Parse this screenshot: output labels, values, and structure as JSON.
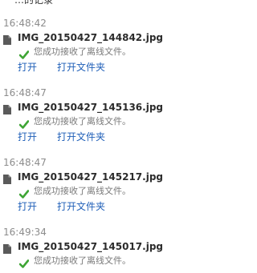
{
  "top_fragment": "…的记录",
  "entries": [
    {
      "time": "16:48:42",
      "file_name": "IMG_20150427_144842.jpg",
      "status": "您成功接收了离线文件。",
      "open_label": "打开",
      "open_folder_label": "打开文件夹"
    },
    {
      "time": "16:48:47",
      "file_name": "IMG_20150427_145136.jpg",
      "status": "您成功接收了离线文件。",
      "open_label": "打开",
      "open_folder_label": "打开文件夹"
    },
    {
      "time": "16:48:47",
      "file_name": "IMG_20150427_145217.jpg",
      "status": "您成功接收了离线文件。",
      "open_label": "打开",
      "open_folder_label": "打开文件夹"
    },
    {
      "time": "16:49:34",
      "file_name": "IMG_20150427_145017.jpg",
      "status": "您成功接收了离线文件。"
    }
  ],
  "icons": {
    "file": "file-icon",
    "check": "check-icon"
  },
  "colors": {
    "link": "#1f5fb8",
    "success_check": "#3fa535",
    "timestamp": "#8c8c8c"
  }
}
